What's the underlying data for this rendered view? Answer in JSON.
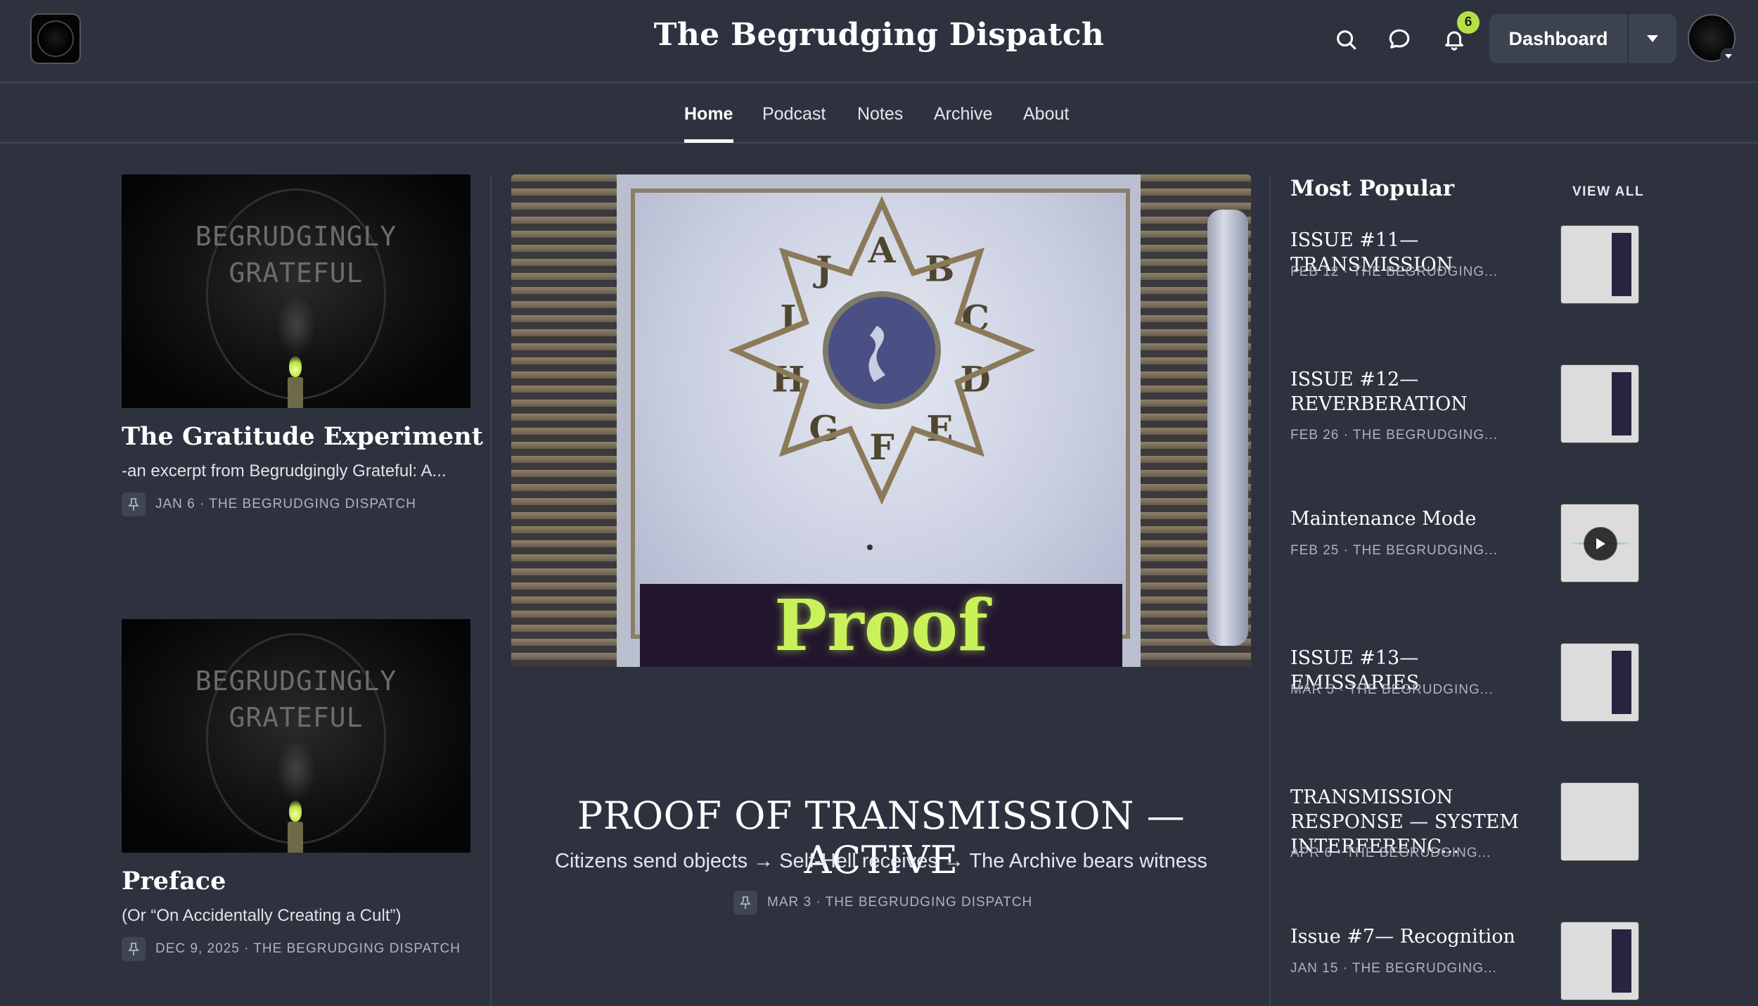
{
  "header": {
    "site_title": "The Begrudging Dispatch",
    "notification_count": "6",
    "dashboard_label": "Dashboard"
  },
  "nav": {
    "items": [
      {
        "label": "Home",
        "active": true
      },
      {
        "label": "Podcast"
      },
      {
        "label": "Notes"
      },
      {
        "label": "Archive"
      },
      {
        "label": "About"
      }
    ]
  },
  "left_posts": [
    {
      "thumb_text": "BEGRUDGINGLY GRATEFUL",
      "title": "The Gratitude Experiment",
      "subtitle": "-an excerpt from Begrudgingly Grateful: A...",
      "meta": "JAN 6 · THE BEGRUDGING DISPATCH"
    },
    {
      "thumb_text": "BEGRUDGINGLY GRATEFUL",
      "title": "Preface",
      "subtitle": "(Or “On Accidentally Creating a Cult”)",
      "meta": "DEC 9, 2025 · THE BEGRUDGING DISPATCH"
    }
  ],
  "featured": {
    "image_text": "Proof",
    "image_letters": [
      "A",
      "B",
      "C",
      "D",
      "E",
      "F",
      "G",
      "H",
      "I",
      "J"
    ],
    "title": "PROOF OF TRANSMISSION — ACTIVE",
    "subtitle": "Citizens send objects → Self-Hell receives → The Archive bears witness",
    "meta": "MAR 3 · THE BEGRUDGING DISPATCH"
  },
  "popular": {
    "heading": "Most Popular",
    "view_all": "VIEW ALL",
    "items": [
      {
        "title": "ISSUE #11— TRANSMISSION",
        "meta": "FEB 12 · THE BEGRUDGING..."
      },
      {
        "title": "ISSUE #12— REVERBERATION",
        "meta": "FEB 26 · THE BEGRUDGING..."
      },
      {
        "title": "Maintenance Mode",
        "meta": "FEB 25 · THE BEGRUDGING..."
      },
      {
        "title": "ISSUE #13—EMISSARIES",
        "meta": "MAR 5 · THE BEGRUDGING..."
      },
      {
        "title": "TRANSMISSION RESPONSE — SYSTEM INTERFERENC...",
        "meta": "APR 6 · THE BEGRUDGING..."
      },
      {
        "title": "Issue #7— Recognition",
        "meta": "JAN 15 · THE BEGRUDGING..."
      }
    ]
  },
  "icons": {
    "search": "search-icon",
    "chat": "chat-icon",
    "bell": "bell-icon",
    "pin": "pin-icon",
    "play": "play-icon"
  },
  "colors": {
    "background": "#2d323e",
    "badge": "#b5e048",
    "proof_text": "#c9f25a"
  }
}
